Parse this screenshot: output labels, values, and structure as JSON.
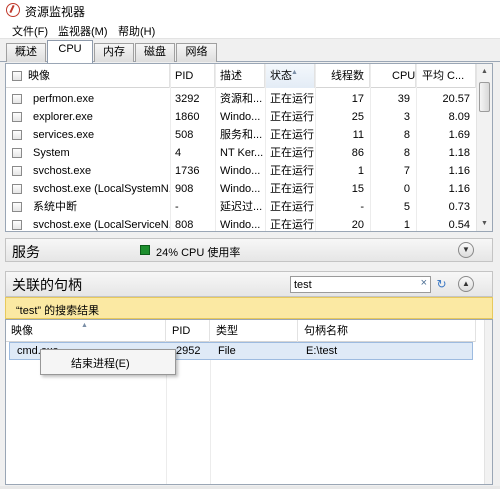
{
  "window": {
    "title": "资源监视器"
  },
  "menu": [
    "文件(F)",
    "监视器(M)",
    "帮助(H)"
  ],
  "tabs": [
    "概述",
    "CPU",
    "内存",
    "磁盘",
    "网络"
  ],
  "active_tab": "CPU",
  "processes": {
    "columns": [
      "映像",
      "PID",
      "描述",
      "状态",
      "线程数",
      "CPU",
      "平均 C..."
    ],
    "rows": [
      {
        "image": "perfmon.exe",
        "pid": "3292",
        "desc": "资源和...",
        "status": "正在运行",
        "threads": "17",
        "cpu": "39",
        "avg": "20.57"
      },
      {
        "image": "explorer.exe",
        "pid": "1860",
        "desc": "Windo...",
        "status": "正在运行",
        "threads": "25",
        "cpu": "3",
        "avg": "8.09"
      },
      {
        "image": "services.exe",
        "pid": "508",
        "desc": "服务和...",
        "status": "正在运行",
        "threads": "11",
        "cpu": "8",
        "avg": "1.69"
      },
      {
        "image": "System",
        "pid": "4",
        "desc": "NT Ker...",
        "status": "正在运行",
        "threads": "86",
        "cpu": "8",
        "avg": "1.18"
      },
      {
        "image": "svchost.exe",
        "pid": "1736",
        "desc": "Windo...",
        "status": "正在运行",
        "threads": "1",
        "cpu": "7",
        "avg": "1.16"
      },
      {
        "image": "svchost.exe (LocalSystemN...",
        "pid": "908",
        "desc": "Windo...",
        "status": "正在运行",
        "threads": "15",
        "cpu": "0",
        "avg": "1.16"
      },
      {
        "image": "系统中断",
        "pid": "-",
        "desc": "延迟过...",
        "status": "正在运行",
        "threads": "-",
        "cpu": "5",
        "avg": "0.73"
      },
      {
        "image": "svchost.exe (LocalServiceN...",
        "pid": "808",
        "desc": "Windo...",
        "status": "正在运行",
        "threads": "20",
        "cpu": "1",
        "avg": "0.54"
      }
    ]
  },
  "services": {
    "title": "服务",
    "cpu_usage": "24% CPU 使用率",
    "indicator_color": "#1d8f2e"
  },
  "handles": {
    "title": "关联的句柄",
    "search_value": "test",
    "clear_icon": "×",
    "go_icon": "↻",
    "result_banner": "“test” 的搜索结果",
    "columns": [
      "映像",
      "PID",
      "类型",
      "句柄名称"
    ],
    "rows": [
      {
        "image": "cmd.exe",
        "pid": "2952",
        "type": "File",
        "name": "E:\\test"
      }
    ]
  },
  "context_menu": {
    "items": [
      "结束进程(E)"
    ]
  },
  "colors": {
    "banner": "#fbe9a3",
    "selection": "#dfeaf7",
    "accent": "#3d79c4"
  }
}
